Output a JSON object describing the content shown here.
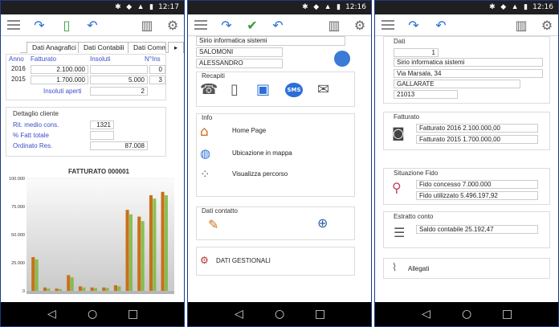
{
  "status": {
    "panel1_time": "12:17",
    "panel2_time": "12:16",
    "panel3_time": "12:16"
  },
  "panel1": {
    "tabs": [
      "Dati Anagrafici",
      "Dati Contabili",
      "Dati Comm"
    ],
    "table_headers": [
      "Anno",
      "Fatturato",
      "Insoluti",
      "N°Ins"
    ],
    "rows": [
      {
        "anno": "2016",
        "fatturato": "2.100.000",
        "insoluti": "",
        "nins": "0"
      },
      {
        "anno": "2015",
        "fatturato": "1.700.000",
        "insoluti": "5.000",
        "nins": "3"
      }
    ],
    "insoluti_aperti_label": "Insoluti aperti",
    "insoluti_aperti_value": "2",
    "dettaglio_title": "Dettaglio cliente",
    "rit_label": "Rit. medio cons.",
    "rit_value": "1321",
    "fatt_label": "% Fatt totale",
    "fatt_value": "",
    "ordinato_label": "Ordinato Res.",
    "ordinato_value": "87.008"
  },
  "chart_data": {
    "type": "bar",
    "title": "FATTURATO 000001",
    "yticks": [
      "100.000",
      "75.000",
      "50.000",
      "25.000",
      "0"
    ],
    "ylim": [
      0,
      100000
    ],
    "series": [
      {
        "values": [
          30000,
          3000,
          2000,
          14000,
          4000,
          3000,
          3000,
          5000,
          72000,
          66000,
          85000,
          88000
        ]
      },
      {
        "values": [
          28000,
          2000,
          1500,
          12000,
          3000,
          2500,
          2500,
          4000,
          68000,
          62000,
          82000,
          85000
        ]
      }
    ],
    "colors": {
      "primary": "#c8701a",
      "secondary": "#7ab83a"
    }
  },
  "panel2": {
    "company": "Sirio informatica sistemi",
    "surname": "SALOMONI",
    "name": "ALESSANDRO",
    "recapiti_title": "Recapiti",
    "recapiti_icons": [
      "phone-icon",
      "mobile-icon",
      "computer-icon",
      "sms-icon",
      "email-icon"
    ],
    "sms_label": "SMS",
    "info_title": "Info",
    "info_items": [
      "Home Page",
      "Ubicazione in mappa",
      "Visualizza percorso"
    ],
    "dati_contatto_title": "Dati contatto",
    "dati_gestionali": "DATI GESTIONALI"
  },
  "panel3": {
    "dati_title": "Dati",
    "code": "1",
    "company": "Sirio informatica sistemi",
    "address": "Via Marsala, 34",
    "city": "GALLARATE",
    "zip": "21013",
    "fatturato_title": "Fatturato",
    "fatturato_rows": [
      "Fatturato 2016 2.100.000,00",
      "Fatturato 2015 1.700.000,00"
    ],
    "fido_title": "Situazione Fido",
    "fido_rows": [
      "Fido concesso 7.000.000",
      "Fido utilizzato 5.496.197,92"
    ],
    "estratto_title": "Estratto conto",
    "estratto_row": "Saldo contabile 25.192,47",
    "allegati": "Allegati"
  }
}
